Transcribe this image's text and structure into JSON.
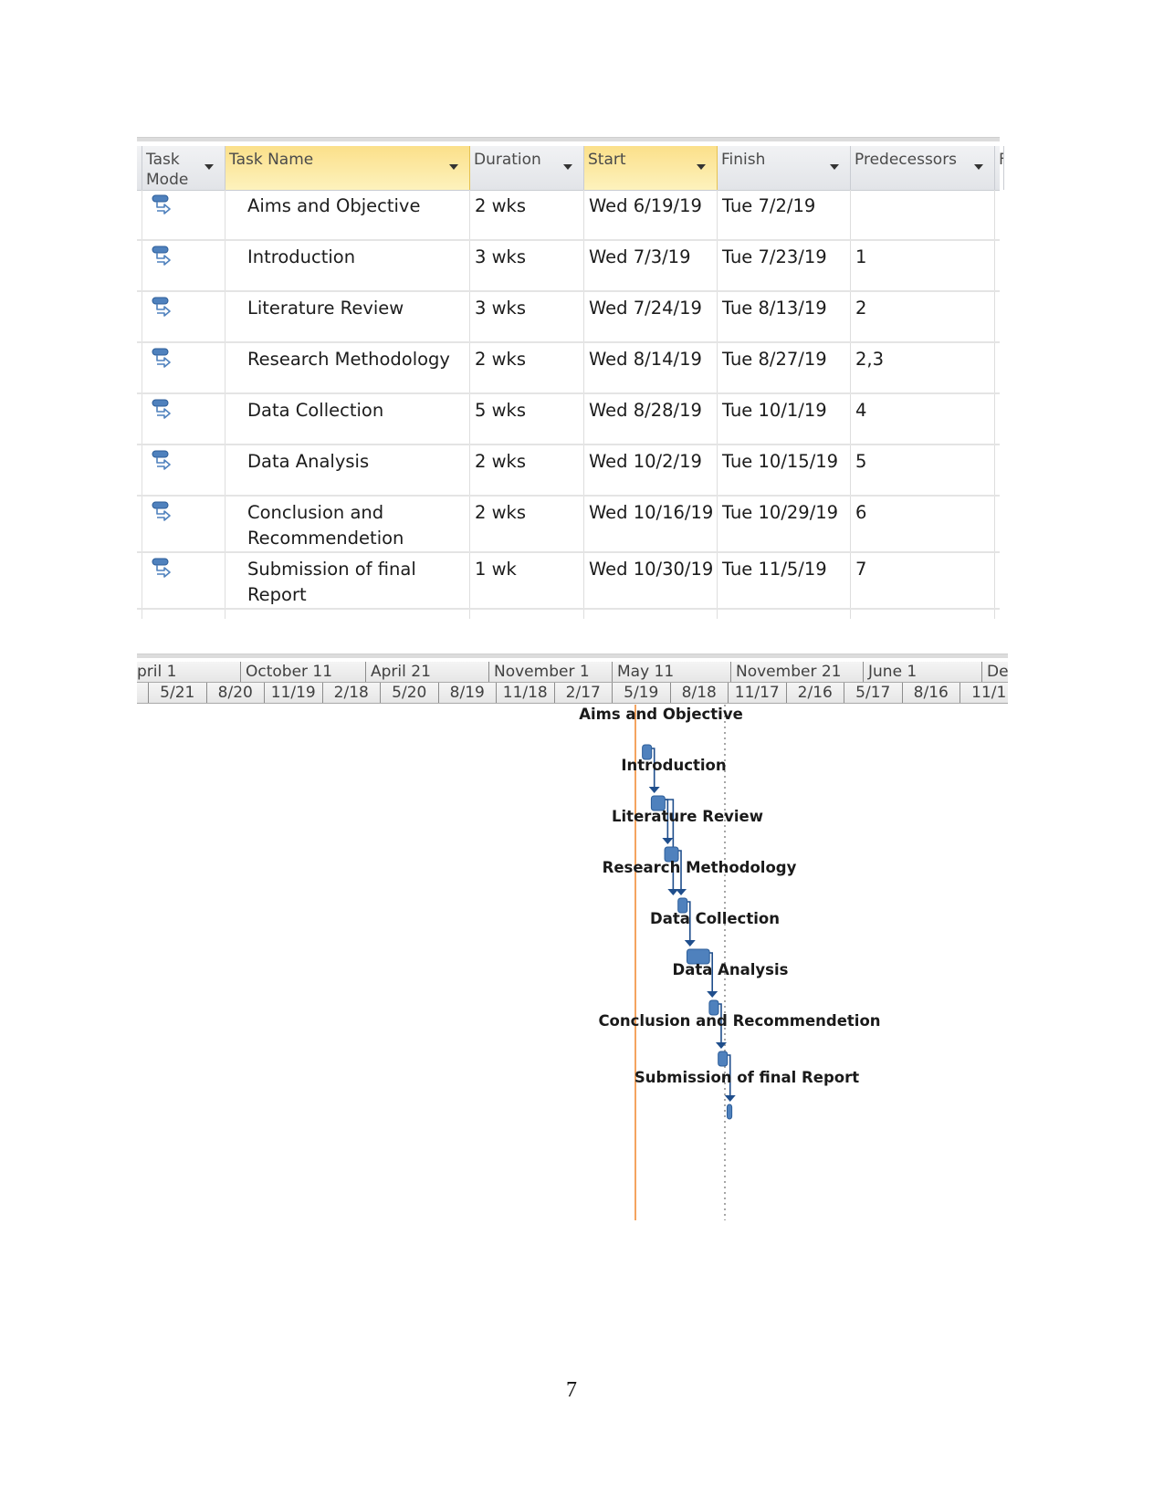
{
  "table": {
    "headers": [
      {
        "label": "Task Mode",
        "selected": false
      },
      {
        "label": "Task Name",
        "selected": true
      },
      {
        "label": "Duration",
        "selected": false
      },
      {
        "label": "Start",
        "selected": true
      },
      {
        "label": "Finish",
        "selected": false
      },
      {
        "label": "Predecessors",
        "selected": false
      },
      {
        "label": "F",
        "selected": false
      }
    ],
    "header_line1_task_mode": "Task",
    "header_line2_task_mode": "Mode",
    "rows": [
      {
        "mode_icon": "auto-scheduled-task-icon",
        "name": "Aims and Objective",
        "duration": "2 wks",
        "start": "Wed 6/19/19",
        "finish": "Tue 7/2/19",
        "predecessors": ""
      },
      {
        "mode_icon": "auto-scheduled-task-icon",
        "name": "Introduction",
        "duration": "3 wks",
        "start": "Wed 7/3/19",
        "finish": "Tue 7/23/19",
        "predecessors": "1"
      },
      {
        "mode_icon": "auto-scheduled-task-icon",
        "name": "Literature Review",
        "duration": "3 wks",
        "start": "Wed 7/24/19",
        "finish": "Tue 8/13/19",
        "predecessors": "2"
      },
      {
        "mode_icon": "auto-scheduled-task-icon",
        "name": "Research Methodology",
        "duration": "2 wks",
        "start": "Wed 8/14/19",
        "finish": "Tue 8/27/19",
        "predecessors": "2,3"
      },
      {
        "mode_icon": "auto-scheduled-task-icon",
        "name": "Data Collection",
        "duration": "5 wks",
        "start": "Wed 8/28/19",
        "finish": "Tue 10/1/19",
        "predecessors": "4"
      },
      {
        "mode_icon": "auto-scheduled-task-icon",
        "name": "Data Analysis",
        "duration": "2 wks",
        "start": "Wed 10/2/19",
        "finish": "Tue 10/15/19",
        "predecessors": "5"
      },
      {
        "mode_icon": "auto-scheduled-task-icon",
        "name_line1": "Conclusion and",
        "name_line2": "Recommendetion",
        "duration": "2 wks",
        "start": "Wed 10/16/19",
        "finish": "Tue 10/29/19",
        "predecessors": "6"
      },
      {
        "mode_icon": "auto-scheduled-task-icon",
        "name_line1": "Submission of final",
        "name_line2": "Report",
        "duration": "1 wk",
        "start": "Wed 10/30/19",
        "finish": "Tue 11/5/19",
        "predecessors": "7"
      }
    ]
  },
  "gantt": {
    "top_tier": [
      "pril 1",
      "October 11",
      "April 21",
      "November 1",
      "May 11",
      "November 21",
      "June 1",
      "De"
    ],
    "bottom_tier": [
      "",
      "5/21",
      "8/20",
      "11/19",
      "2/18",
      "5/20",
      "8/19",
      "11/18",
      "2/17",
      "5/19",
      "8/18",
      "11/17",
      "2/16",
      "5/17",
      "8/16",
      "11/1"
    ],
    "bars": [
      {
        "label": "Aims and Objective",
        "start": "2019-06-19",
        "finish": "2019-07-02"
      },
      {
        "label": "Introduction",
        "start": "2019-07-03",
        "finish": "2019-07-23"
      },
      {
        "label": "Literature Review",
        "start": "2019-07-24",
        "finish": "2019-08-13"
      },
      {
        "label": "Research Methodology",
        "start": "2019-08-14",
        "finish": "2019-08-27"
      },
      {
        "label": "Data Collection",
        "start": "2019-08-28",
        "finish": "2019-10-01"
      },
      {
        "label": "Data Analysis",
        "start": "2019-10-02",
        "finish": "2019-10-15"
      },
      {
        "label": "Conclusion and Recommendetion",
        "start": "2019-10-16",
        "finish": "2019-10-29"
      },
      {
        "label": "Submission of final Report",
        "start": "2019-10-30",
        "finish": "2019-11-05"
      }
    ],
    "links": [
      [
        0,
        1
      ],
      [
        1,
        2
      ],
      [
        1,
        3
      ],
      [
        2,
        3
      ],
      [
        3,
        4
      ],
      [
        4,
        5
      ],
      [
        5,
        6
      ],
      [
        6,
        7
      ]
    ],
    "colors": {
      "bar": "#4f81bd",
      "bar_border": "#2c5d99",
      "link": "#1f4e8c",
      "today_line": "#f4a460",
      "status_line": "#888888"
    }
  },
  "page_number": "7"
}
